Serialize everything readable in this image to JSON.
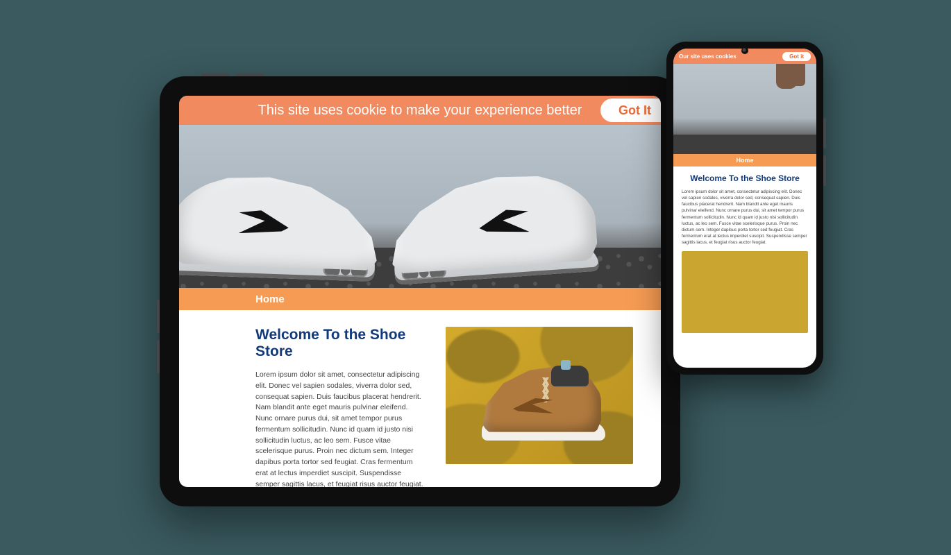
{
  "tablet": {
    "cookie": {
      "message": "This site uses cookie to make your experience better",
      "button": "Got It"
    },
    "nav": {
      "home": "Home"
    },
    "main": {
      "heading": "Welcome To the Shoe Store",
      "body": "Lorem ipsum dolor sit amet, consectetur adipiscing elit. Donec vel sapien sodales, viverra dolor sed, consequat sapien. Duis faucibus placerat hendrerit. Nam blandit ante eget mauris pulvinar eleifend. Nunc ornare purus dui, sit amet tempor purus fermentum sollicitudin. Nunc id quam id justo nisi sollicitudin luctus, ac leo sem. Fusce vitae scelerisque purus. Proin nec dictum sem. Integer dapibus porta tortor sed feugiat. Cras fermentum erat at lectus imperdiet suscipit. Suspendisse semper sagittis lacus, et feugiat risus auctor feugiat. Vivamus laoreet vehicula finibus. Ut cursus tortor, ac tortor nunc. Nunc vitae dictum mauris. Praesent lectus felis ligula, eleifend vulputate sapien rhoncus dapibus. Suspendisse potenti."
    }
  },
  "phone": {
    "cookie": {
      "message": "Our site uses cookies",
      "button": "Got it"
    },
    "nav": {
      "home": "Home"
    },
    "main": {
      "heading": "Welcome To the Shoe Store",
      "body": "Lorem ipsum dolor sit amet, consectetur adipiscing elit. Donec vel sapien sodales, viverra dolor sed, consequat sapien. Duis faucibus placerat hendrerit. Nam blandit ante eget mauris pulvinar eleifend. Nunc ornare purus dui, sit amet tempor purus fermentum sollicitudin. Nunc id quam id justo nisi sollicitudin luctus, ac leo sem. Fusce vitae scelerisque purus. Proin nec dictum sem. Integer dapibus porta tortor sed feugiat. Cras fermentum erat at lectus imperdiet suscipit. Suspendisse semper sagittis lacus, et feugiat risus auctor feugiat."
    }
  }
}
